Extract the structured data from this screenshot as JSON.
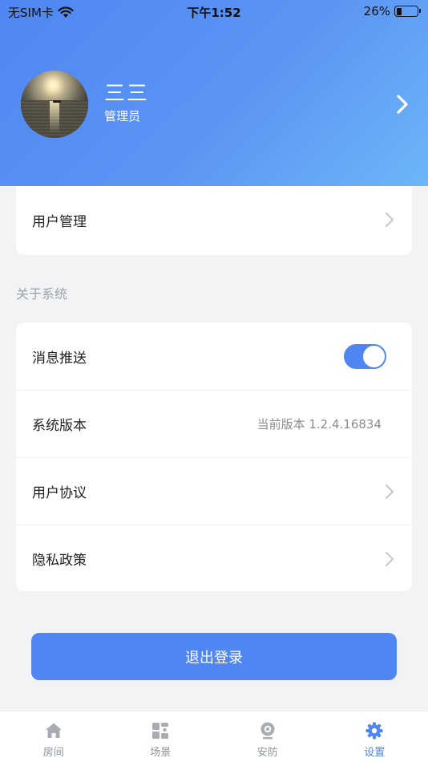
{
  "status_bar": {
    "carrier": "无SIM卡",
    "time": "下午1:52",
    "battery": "26%",
    "battery_level": 0.26
  },
  "profile": {
    "name": "三三",
    "role": "管理员"
  },
  "account_section": {
    "items": [
      {
        "label": "用户管理"
      }
    ]
  },
  "about_section": {
    "title": "关于系统",
    "push": {
      "label": "消息推送",
      "enabled": true
    },
    "version": {
      "label": "系统版本",
      "value": "当前版本 1.2.4.16834"
    },
    "agreement": {
      "label": "用户协议"
    },
    "privacy": {
      "label": "隐私政策"
    }
  },
  "logout_label": "退出登录",
  "tabs": [
    {
      "label": "房间",
      "icon": "home-icon",
      "active": false
    },
    {
      "label": "场景",
      "icon": "grid-icon",
      "active": false
    },
    {
      "label": "安防",
      "icon": "camera-icon",
      "active": false
    },
    {
      "label": "设置",
      "icon": "gear-icon",
      "active": true
    }
  ],
  "colors": {
    "accent": "#4f86f1",
    "header_start": "#4f86f1",
    "header_end": "#6cb6f8",
    "background": "#f2f3f5"
  }
}
